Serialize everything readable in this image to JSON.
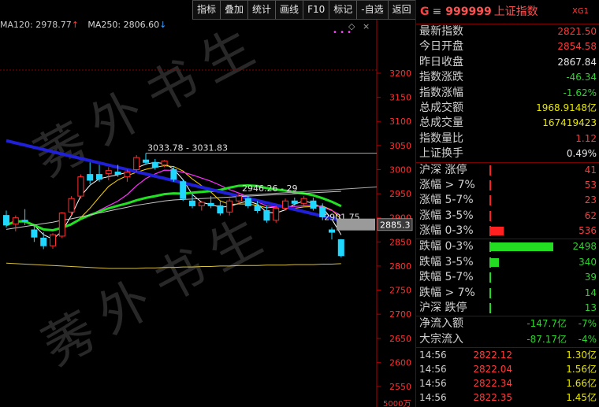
{
  "toolbar": [
    "指标",
    "叠加",
    "统计",
    "画线",
    "F10",
    "标记",
    "-自选",
    "返回"
  ],
  "ma_legend": {
    "ma120_label": "MA120: 2978.77",
    "ma120_arrow": "↑",
    "ma250_label": "MA250: 2806.60",
    "ma250_arrow": "↓",
    "ma120_color": "#c8c8c8",
    "ma250_color": "#d8d8d8"
  },
  "watermark": "莠外书生",
  "chart_data": {
    "type": "candlestick",
    "y_ticks": [
      3200,
      3150,
      3100,
      3050,
      3000,
      2950,
      2900,
      2850,
      2800,
      2750,
      2700,
      2650,
      2600,
      2550
    ],
    "ylim": [
      2500,
      3230
    ],
    "y_ticks_below": [
      "5000万"
    ],
    "annotations": [
      {
        "text": "3033.78 - 3031.83",
        "type": "range"
      },
      {
        "text": "2946.26 - 29",
        "type": "range"
      },
      {
        "text": "2901.75",
        "type": "price"
      }
    ],
    "price_tag": {
      "text": "2885.3",
      "value": 2885.3
    },
    "candles": [
      {
        "o": 2905,
        "h": 2915,
        "l": 2880,
        "c": 2885
      },
      {
        "o": 2887,
        "h": 2905,
        "l": 2872,
        "c": 2900
      },
      {
        "o": 2895,
        "h": 2918,
        "l": 2885,
        "c": 2893
      },
      {
        "o": 2875,
        "h": 2882,
        "l": 2850,
        "c": 2860
      },
      {
        "o": 2858,
        "h": 2870,
        "l": 2835,
        "c": 2842
      },
      {
        "o": 2842,
        "h": 2868,
        "l": 2836,
        "c": 2865
      },
      {
        "o": 2862,
        "h": 2912,
        "l": 2858,
        "c": 2910
      },
      {
        "o": 2912,
        "h": 2945,
        "l": 2905,
        "c": 2940
      },
      {
        "o": 2945,
        "h": 2990,
        "l": 2940,
        "c": 2985
      },
      {
        "o": 2990,
        "h": 3015,
        "l": 2970,
        "c": 2978
      },
      {
        "o": 2990,
        "h": 3010,
        "l": 2975,
        "c": 2980
      },
      {
        "o": 2992,
        "h": 3005,
        "l": 2978,
        "c": 2998
      },
      {
        "o": 2995,
        "h": 3010,
        "l": 2985,
        "c": 2990
      },
      {
        "o": 2985,
        "h": 3000,
        "l": 2975,
        "c": 2995
      },
      {
        "o": 3000,
        "h": 3030,
        "l": 2995,
        "c": 3025
      },
      {
        "o": 3020,
        "h": 3034,
        "l": 3010,
        "c": 3015
      },
      {
        "o": 3015,
        "h": 3022,
        "l": 3000,
        "c": 3005
      },
      {
        "o": 3010,
        "h": 3020,
        "l": 3005,
        "c": 3018
      },
      {
        "o": 3000,
        "h": 3005,
        "l": 2975,
        "c": 2980
      },
      {
        "o": 2975,
        "h": 2980,
        "l": 2935,
        "c": 2940
      },
      {
        "o": 2935,
        "h": 2950,
        "l": 2920,
        "c": 2925
      },
      {
        "o": 2925,
        "h": 2935,
        "l": 2915,
        "c": 2932
      },
      {
        "o": 2930,
        "h": 2945,
        "l": 2920,
        "c": 2925
      },
      {
        "o": 2925,
        "h": 2935,
        "l": 2905,
        "c": 2910
      },
      {
        "o": 2912,
        "h": 2940,
        "l": 2905,
        "c": 2935
      },
      {
        "o": 2935,
        "h": 2950,
        "l": 2928,
        "c": 2945
      },
      {
        "o": 2940,
        "h": 2946,
        "l": 2920,
        "c": 2925
      },
      {
        "o": 2925,
        "h": 2935,
        "l": 2910,
        "c": 2915
      },
      {
        "o": 2915,
        "h": 2925,
        "l": 2890,
        "c": 2895
      },
      {
        "o": 2895,
        "h": 2925,
        "l": 2890,
        "c": 2920
      },
      {
        "o": 2920,
        "h": 2940,
        "l": 2915,
        "c": 2935
      },
      {
        "o": 2935,
        "h": 2942,
        "l": 2925,
        "c": 2930
      },
      {
        "o": 2930,
        "h": 2945,
        "l": 2925,
        "c": 2940
      },
      {
        "o": 2935,
        "h": 2942,
        "l": 2915,
        "c": 2920
      },
      {
        "o": 2922,
        "h": 2930,
        "l": 2895,
        "c": 2902
      },
      {
        "o": 2875,
        "h": 2880,
        "l": 2855,
        "c": 2870
      },
      {
        "o": 2854.58,
        "h": 2856,
        "l": 2818,
        "c": 2821.5
      }
    ],
    "series": [
      {
        "name": "MA120",
        "color": "#c8c8c8",
        "values": [
          2876,
          2879,
          2882,
          2885,
          2888,
          2891,
          2895,
          2898,
          2902,
          2906,
          2910,
          2914,
          2918,
          2922,
          2926,
          2929,
          2932,
          2935,
          2937,
          2938,
          2939,
          2940,
          2941,
          2942,
          2943,
          2944,
          2945,
          2946,
          2947,
          2948,
          2949,
          2950,
          2951,
          2952,
          2953,
          2954,
          2955
        ]
      },
      {
        "name": "MA250",
        "color": "#d8d8d8",
        "values": [
          2806,
          2805,
          2804,
          2803,
          2802,
          2801,
          2800,
          2799,
          2798,
          2797,
          2796,
          2795,
          2795,
          2795,
          2795,
          2796,
          2796,
          2797,
          2797,
          2798,
          2798,
          2799,
          2799,
          2800,
          2800,
          2801,
          2801,
          2801,
          2802,
          2802,
          2802,
          2803,
          2803,
          2803,
          2804,
          2804,
          2805
        ]
      }
    ]
  },
  "quote": {
    "title": {
      "g": "G",
      "menu": "≡",
      "code": "999999",
      "name": "上证指数",
      "tag": "XG1"
    },
    "stats": [
      {
        "label": "最新指数",
        "value": "2821.50",
        "color": "red"
      },
      {
        "label": "今日开盘",
        "value": "2854.58",
        "color": "red"
      },
      {
        "label": "昨日收盘",
        "value": "2867.84",
        "color": "wht"
      },
      {
        "label": "指数涨跌",
        "value": "-46.34",
        "color": "grn"
      },
      {
        "label": "指数涨幅",
        "value": "-1.62%",
        "color": "grn"
      },
      {
        "label": "总成交额",
        "value": "1968.9148亿",
        "color": "yel"
      },
      {
        "label": "总成交量",
        "value": "167419423",
        "color": "yel"
      },
      {
        "label": "指数量比",
        "value": "1.12",
        "color": "red"
      },
      {
        "label": "上证换手",
        "value": "0.49%",
        "color": "wht"
      }
    ],
    "breadth_up": [
      {
        "label": "沪深 涨停",
        "value": "41",
        "bar_ratio": 0.0
      },
      {
        "label": "涨幅 > 7%",
        "value": "53",
        "bar_ratio": 0.0
      },
      {
        "label": "涨幅 5-7%",
        "value": "23",
        "bar_ratio": 0.0
      },
      {
        "label": "涨幅 3-5%",
        "value": "62",
        "bar_ratio": 0.0
      },
      {
        "label": "涨幅 0-3%",
        "value": "536",
        "bar_ratio": 0.215
      }
    ],
    "breadth_down": [
      {
        "label": "跌幅 0-3%",
        "value": "2498",
        "bar_ratio": 1.0
      },
      {
        "label": "跌幅 3-5%",
        "value": "340",
        "bar_ratio": 0.136
      },
      {
        "label": "跌幅 5-7%",
        "value": "39",
        "bar_ratio": 0.0
      },
      {
        "label": "跌幅 > 7%",
        "value": "14",
        "bar_ratio": 0.0
      },
      {
        "label": "沪深 跌停",
        "value": "13",
        "bar_ratio": 0.0
      }
    ],
    "flows": [
      {
        "label": "净流入额",
        "value": "-147.7亿",
        "pct": "-7%"
      },
      {
        "label": "大宗流入",
        "value": "-87.17亿",
        "pct": "-4%"
      }
    ],
    "ticks": [
      {
        "time": "14:56",
        "price": "2822.12",
        "vol": "1.30亿"
      },
      {
        "time": "14:56",
        "price": "2822.04",
        "vol": "1.56亿"
      },
      {
        "time": "14:56",
        "price": "2822.34",
        "vol": "1.66亿"
      },
      {
        "time": "14:56",
        "price": "2822.35",
        "vol": "1.45亿"
      }
    ]
  }
}
